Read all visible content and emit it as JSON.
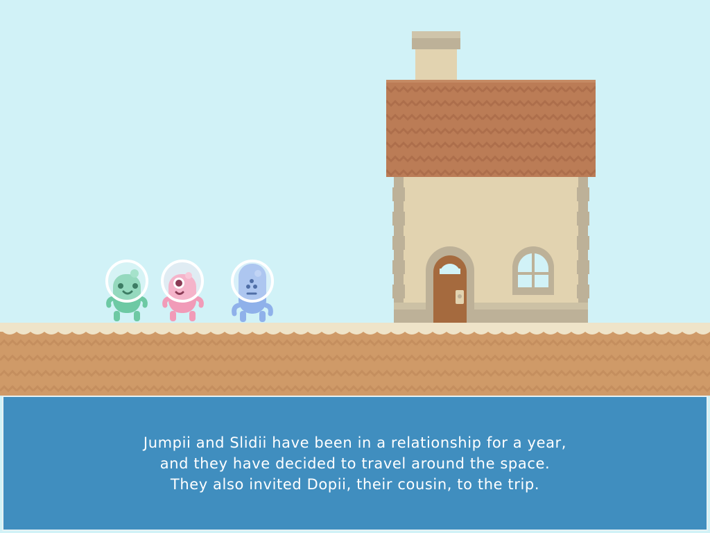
{
  "story": {
    "lines": [
      "Jumpii and Slidii have been in a relationship for a year,",
      "and they have decided to travel around the space.",
      "They also invited Dopii, their cousin, to the trip."
    ]
  },
  "characters": [
    {
      "name": "green-alien",
      "color": "#6dc9a4"
    },
    {
      "name": "pink-alien",
      "color": "#f19bb8"
    },
    {
      "name": "blue-alien",
      "color": "#8fb1ea"
    }
  ],
  "colors": {
    "sky": "#d1f2f7",
    "ground_top": "#efe4c9",
    "ground": "#cf9a68",
    "roof": "#bb7c56",
    "wall": "#e2d3b0",
    "door": "#a56a3e",
    "dialog_bg": "#408ebf"
  }
}
